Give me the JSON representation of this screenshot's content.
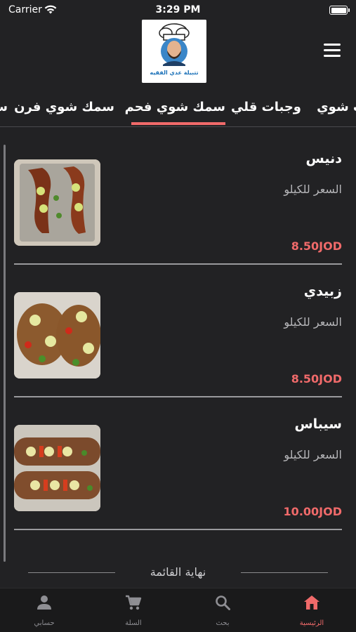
{
  "status_bar": {
    "carrier": "Carrier",
    "time": "3:29 PM"
  },
  "header": {
    "logo_text": "تتبيلة عدي الفقيه"
  },
  "tabs": [
    {
      "label": "ت شوي",
      "active": false
    },
    {
      "label": "وجبات قلي",
      "active": false
    },
    {
      "label": "سمك شوي فحم",
      "active": true
    },
    {
      "label": "سمك شوي فرن",
      "active": false
    },
    {
      "label": "س",
      "active": false
    }
  ],
  "items": [
    {
      "name": "دنيس",
      "desc": "السعر للكيلو",
      "price": "8.50JOD"
    },
    {
      "name": "زبيدي",
      "desc": "السعر للكيلو",
      "price": "8.50JOD"
    },
    {
      "name": "سيباس",
      "desc": "السعر للكيلو",
      "price": "10.00JOD"
    }
  ],
  "end_of_list": "نهاية القائمة",
  "bottom_nav": [
    {
      "label": "الرئيسية",
      "icon": "home-icon",
      "active": true
    },
    {
      "label": "بحث",
      "icon": "search-icon",
      "active": false
    },
    {
      "label": "السلة",
      "icon": "cart-icon",
      "active": false
    },
    {
      "label": "حسابي",
      "icon": "user-icon",
      "active": false
    }
  ],
  "colors": {
    "accent": "#f06a6a",
    "background": "#222224",
    "nav_background": "#1a1a1b"
  }
}
